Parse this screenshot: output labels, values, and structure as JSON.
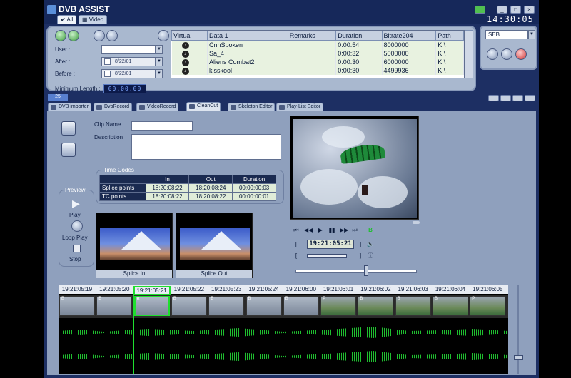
{
  "app": {
    "title": "DVB ASSIST",
    "clock": "14:30:05"
  },
  "top_tabs": [
    {
      "label": "All"
    },
    {
      "label": "Video"
    }
  ],
  "window_buttons": [
    "_",
    "□",
    "×"
  ],
  "filters": {
    "user_label": "User :",
    "after_label": "After :",
    "before_label": "Before :",
    "after_date": "8/22/01",
    "before_date": "8/22/01",
    "min_length_label": "Minimum Length :",
    "min_length_value": "00:00:00"
  },
  "clip_table": {
    "columns": [
      "Virtual",
      "Data 1",
      "Remarks",
      "Duration",
      "Bitrate204",
      "Path"
    ],
    "rows": [
      {
        "data1": "CnnSpoken",
        "remarks": "",
        "duration": "0:00:54",
        "bitrate": "8000000",
        "path": "K:\\"
      },
      {
        "data1": "Sa_4",
        "remarks": "",
        "duration": "0:00:32",
        "bitrate": "5000000",
        "path": "K:\\"
      },
      {
        "data1": "Aliens Combat2",
        "remarks": "",
        "duration": "0:00:30",
        "bitrate": "6000000",
        "path": "K:\\"
      },
      {
        "data1": "kisskool",
        "remarks": "",
        "duration": "0:00:30",
        "bitrate": "4499936",
        "path": "K:\\"
      }
    ]
  },
  "right_panel": {
    "select_value": "SEB"
  },
  "count_badge": "25",
  "tabs": [
    {
      "label": "DVB importer"
    },
    {
      "label": "DvbRecord"
    },
    {
      "label": "VideoRecord"
    },
    {
      "label": "CleanCut"
    },
    {
      "label": "Skeleton Editor"
    },
    {
      "label": "Play-List Editor"
    }
  ],
  "cleancut": {
    "clip_name_label": "Clip Name",
    "description_label": "Description",
    "timecodes_label": "Time Codes",
    "tc_headers": [
      "In",
      "Out",
      "Duration"
    ],
    "tc_rows": [
      {
        "label": "Splice points",
        "in": "18:20:08:22",
        "out": "18:20:08:24",
        "duration": "00:00:00:03"
      },
      {
        "label": "TC points",
        "in": "18:20:08:22",
        "out": "18:20:08:22",
        "duration": "00:00:00:01"
      }
    ],
    "preview_label": "Preview",
    "play_label": "Play",
    "loop_label": "Loop Play",
    "stop_label": "Stop",
    "splice_in_label": "Splice In",
    "splice_out_label": "Splice Out"
  },
  "player": {
    "timecode": "19:21:05:21",
    "bd_label": "B"
  },
  "timeline": {
    "ticks": [
      "19:21:05:19",
      "19:21:05:20",
      "19:21:05:21",
      "19:21:05:22",
      "19:21:05:23",
      "19:21:05:24",
      "19:21:06:00",
      "19:21:06:01",
      "19:21:06:02",
      "19:21:06:03",
      "19:21:06:04",
      "19:21:06:05"
    ],
    "frame_types": [
      "B",
      "B",
      "B",
      "B",
      "B",
      "B",
      "B",
      "P",
      "B",
      "B",
      "B",
      "P"
    ]
  },
  "colors": {
    "accent": "#1d2f63",
    "panel": "#a9b8cf",
    "wave": "#1fbf2f",
    "selected": "#1fdf2f"
  }
}
